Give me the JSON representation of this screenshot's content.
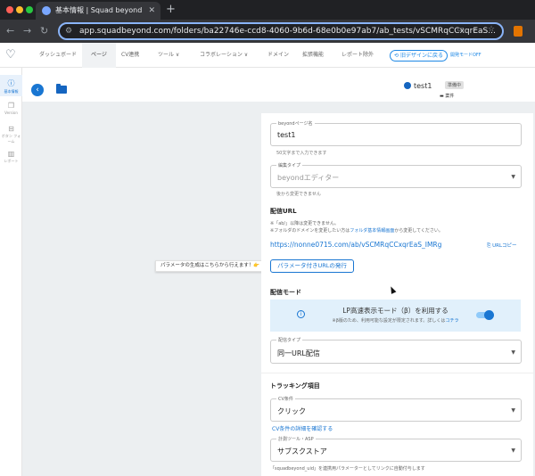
{
  "browser": {
    "tab_title": "基本情報 | Squad beyond",
    "url": "app.squadbeyond.com/folders/ba22746e-ccd8-4060-9b6d-68e0b0e97ab7/ab_tests/vSCMRqCCxqrEaS..."
  },
  "header": {
    "nav": [
      "ダッシュボード",
      "ページ",
      "CV連携",
      "ツール ∨",
      "コラボレーション ∨",
      "ドメイン",
      "拡張機能",
      "レポート除外"
    ],
    "old_design_button": "旧デザインに戻る",
    "old_mode_link": "開発モードOFF"
  },
  "sidebar": {
    "items": [
      "基本情報",
      "Version",
      "ボタン\nフォーム",
      "レポート"
    ]
  },
  "project": {
    "name": "test1",
    "status": "準備中",
    "sub": "案件"
  },
  "tooltip": "パラメータの生成はこちらから行えます！👉",
  "form": {
    "page_name_label": "beyondページ名",
    "page_name_value": "test1",
    "page_name_hint": "50文字まで入力できます",
    "edit_type_label": "編集タイプ",
    "edit_type_value": "beyondエディター",
    "edit_type_hint": "後から変更できません",
    "url_section": "配信URL",
    "url_note1": "※「ab/」以降は変更できません。",
    "url_note2_pre": "※フォルダのドメインを変更したい方は",
    "url_note2_link": "フォルダ基本情報画面",
    "url_note2_post": "から変更してください。",
    "url_value": "https://nonne0715.com/ab/vSCMRqCCxqrEaS_IMRg",
    "url_copy": "⎘ URLコピー",
    "param_button": "パラメータ付きURLの発行",
    "mode_section": "配信モード",
    "lp_title": "LP高速表示モード（β）を利用する",
    "lp_sub_pre": "※β版のため、利用可能な設定が限定されます。詳しくは",
    "lp_sub_link": "コチラ",
    "lp_enabled": true,
    "delivery_label": "配信タイプ",
    "delivery_value": "同一URL配信",
    "tracking_section": "トラッキング項目",
    "cv_label": "CV条件",
    "cv_value": "クリック",
    "cv_link": "CV条件の詳細を確認する",
    "tool_label": "計測ツール・ASP",
    "tool_value": "サブスクストア",
    "tool_note": "「squadbeyond_uid」を連携用パラメーターとしてリンクに自動付与します"
  },
  "colors": {
    "accent": "#1976d2",
    "lp_box": "#e1f0fb",
    "content_bg": "#eceff1"
  }
}
